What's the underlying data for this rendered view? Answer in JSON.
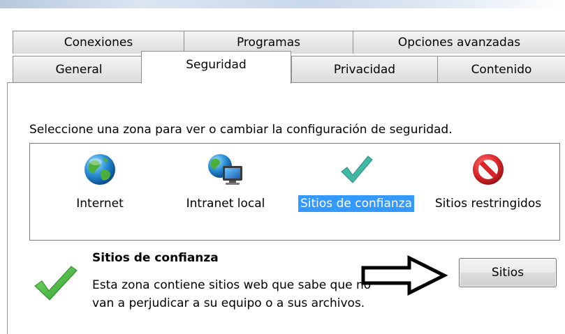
{
  "tabs": {
    "row1": [
      "Conexiones",
      "Programas",
      "Opciones avanzadas"
    ],
    "row2": [
      "General",
      "Seguridad",
      "Privacidad",
      "Contenido"
    ],
    "active": "Seguridad"
  },
  "security": {
    "instruction": "Seleccione una zona para ver o cambiar la configuración de seguridad.",
    "zones": [
      {
        "label": "Internet",
        "icon": "globe-icon"
      },
      {
        "label": "Intranet local",
        "icon": "globe-monitor-icon"
      },
      {
        "label": "Sitios de confianza",
        "icon": "checkmark-icon",
        "selected": true
      },
      {
        "label": "Sitios restringidos",
        "icon": "no-entry-icon"
      }
    ],
    "selected_zone": {
      "title": "Sitios de confianza",
      "description_line1": "Esta zona contiene sitios web que sabe que no",
      "description_line2": "van a perjudicar a su equipo o a sus archivos."
    },
    "sites_button": "Sitios"
  },
  "colors": {
    "selection": "#3399ff",
    "check_green": "#3aa63a",
    "restricted_red": "#d9262a"
  }
}
